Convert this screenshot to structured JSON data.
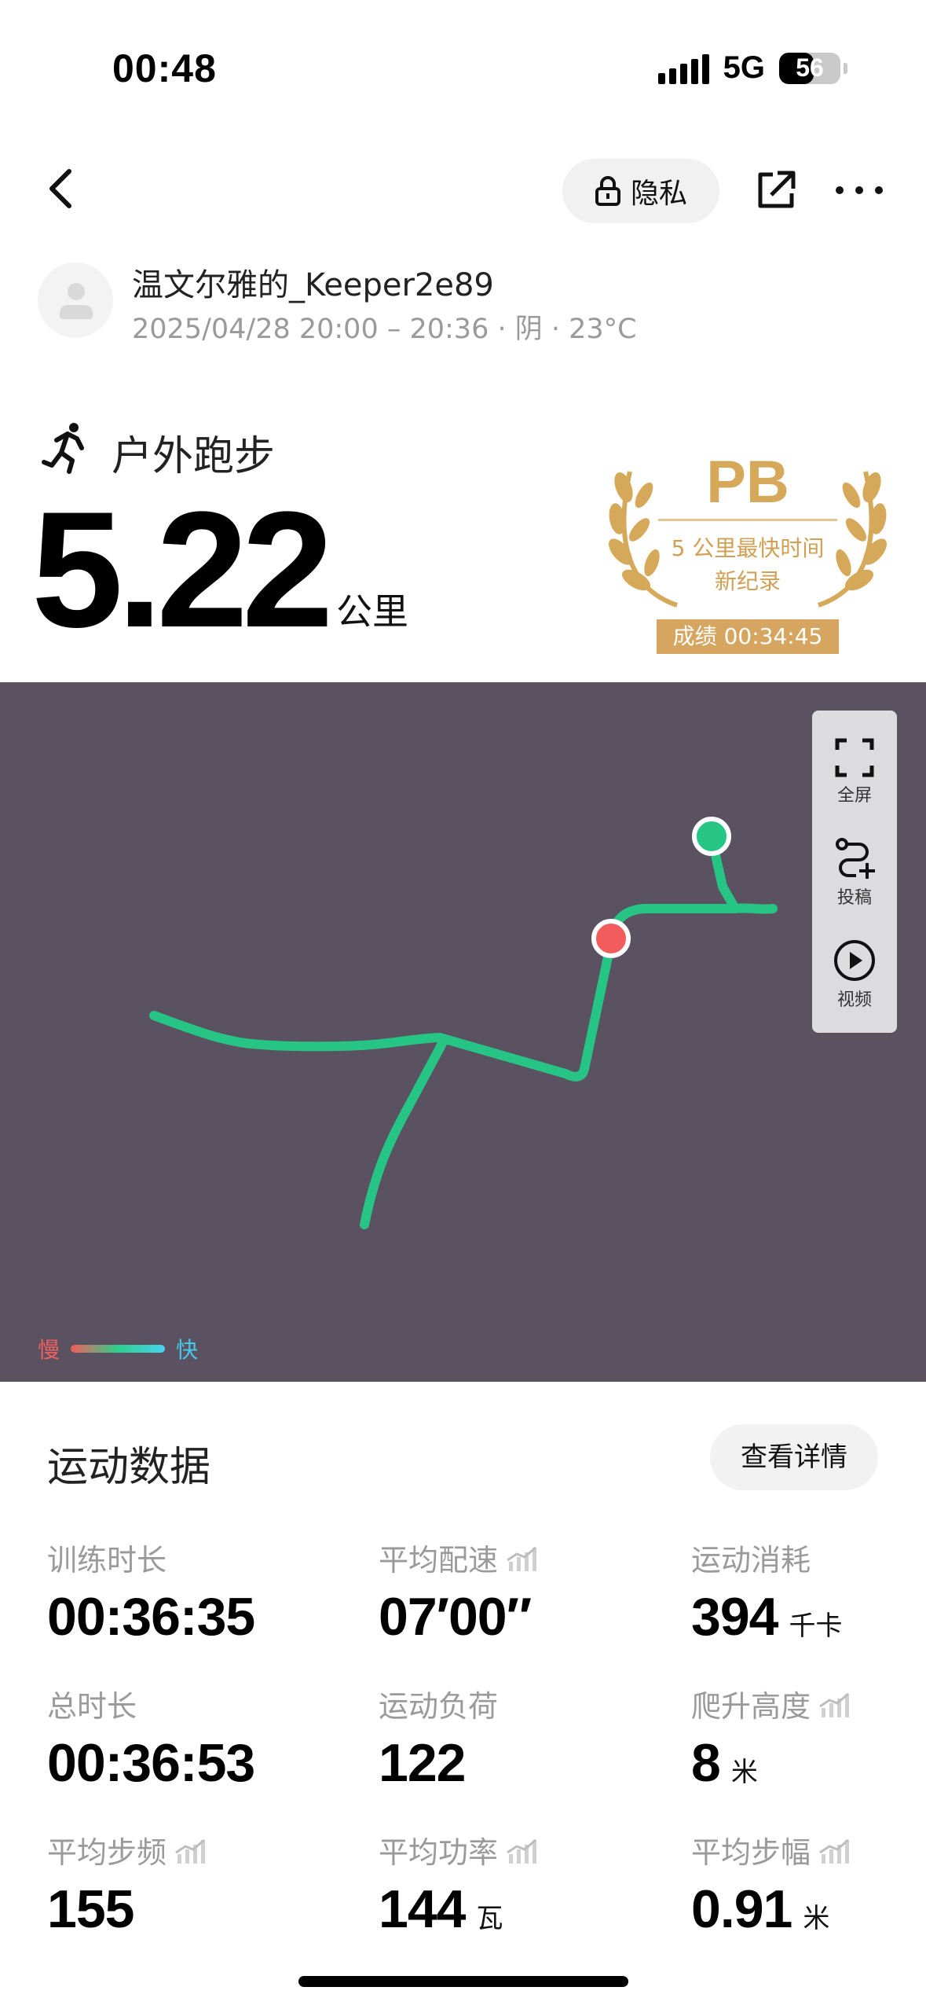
{
  "status_bar": {
    "time": "00:48",
    "network": "5G",
    "battery_level": "56",
    "battery_fraction": 0.56
  },
  "nav": {
    "privacy_label": "隐私"
  },
  "user": {
    "name": "温文尔雅的_Keeper2e89",
    "meta": "2025/04/28 20:00 – 20:36 · 阴 · 23°C"
  },
  "activity": {
    "type": "户外跑步",
    "distance": "5.22",
    "distance_unit": "公里"
  },
  "pb_badge": {
    "title": "PB",
    "line1": "5 公里最快时间",
    "line2": "新纪录",
    "score": "成绩 00:34:45",
    "color": "#d6a85a"
  },
  "map": {
    "background": "#5a5161",
    "route_color": "#26c485",
    "start_color": "#26c485",
    "end_color": "#f25c5c",
    "tools": [
      {
        "icon": "fullscreen-icon",
        "label": "全屏"
      },
      {
        "icon": "route-plus-icon",
        "label": "投稿"
      },
      {
        "icon": "play-icon",
        "label": "视频"
      }
    ],
    "legend": {
      "slow": "慢",
      "fast": "快"
    }
  },
  "data_panel": {
    "title": "运动数据",
    "detail_button": "查看详情",
    "stats": [
      {
        "label": "训练时长",
        "value": "00:36:35",
        "unit": "",
        "trend": false
      },
      {
        "label": "平均配速",
        "value": "07′00″",
        "unit": "",
        "trend": true
      },
      {
        "label": "运动消耗",
        "value": "394",
        "unit": "千卡",
        "trend": false
      },
      {
        "label": "总时长",
        "value": "00:36:53",
        "unit": "",
        "trend": false
      },
      {
        "label": "运动负荷",
        "value": "122",
        "unit": "",
        "trend": false
      },
      {
        "label": "爬升高度",
        "value": "8",
        "unit": "米",
        "trend": true
      },
      {
        "label": "平均步频",
        "value": "155",
        "unit": "",
        "trend": true
      },
      {
        "label": "平均功率",
        "value": "144",
        "unit": "瓦",
        "trend": true
      },
      {
        "label": "平均步幅",
        "value": "0.91",
        "unit": "米",
        "trend": true
      }
    ]
  }
}
